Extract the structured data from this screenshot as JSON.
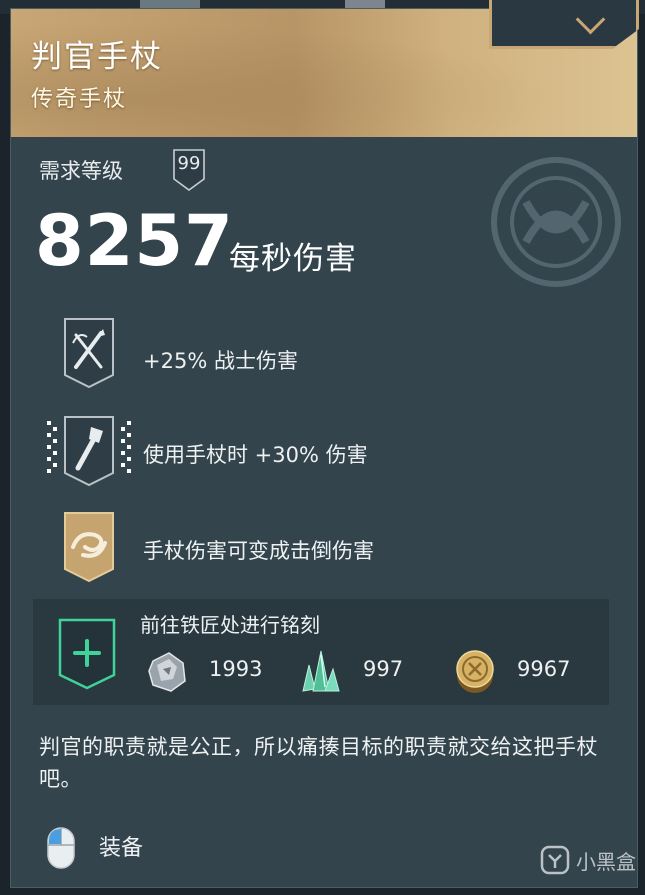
{
  "item": {
    "name": "判官手杖",
    "rarity": "传奇手杖"
  },
  "requirement": {
    "label": "需求等级",
    "level": "99"
  },
  "damage": {
    "value": "8257",
    "unit": "每秒伤害"
  },
  "perks": [
    {
      "icon": "crossed-swords-icon",
      "text": "+25% 战士伤害"
    },
    {
      "icon": "staff-icon",
      "text": "使用手杖时 +30% 伤害"
    },
    {
      "icon": "swirl-icon",
      "text": "手杖伤害可变成击倒伤害"
    }
  ],
  "engraving": {
    "icon": "plus-icon",
    "title": "前往铁匠处进行铭刻",
    "resources": [
      {
        "icon": "iron-ore-icon",
        "value": "1993"
      },
      {
        "icon": "crystal-icon",
        "value": "997"
      },
      {
        "icon": "coin-icon",
        "value": "9967"
      }
    ]
  },
  "description": "判官的职责就是公正，所以痛揍目标的职责就交给这把手杖吧。",
  "action": {
    "icon": "mouse-icon",
    "label": "装备"
  },
  "watermark": {
    "logo": "xiaoheihe-logo-icon",
    "text": "小黑盒"
  },
  "colors": {
    "header_gold": "#c8a675",
    "panel": "#33444d",
    "plus_green": "#3fd39a"
  }
}
